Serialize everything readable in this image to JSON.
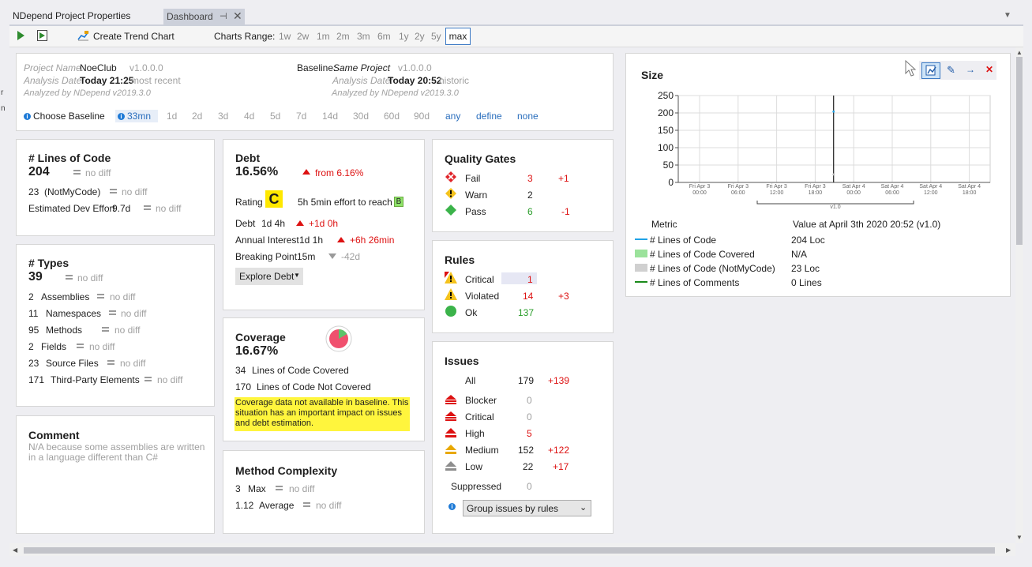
{
  "window": {
    "title": "NDepend Project Properties",
    "tab_label": "Dashboard",
    "tab_pin": "⊣",
    "tab_close": "✕"
  },
  "toolbar": {
    "create_trend_chart": "Create Trend Chart",
    "charts_range_label": "Charts Range:",
    "ranges": [
      "1w",
      "2w",
      "1m",
      "2m",
      "3m",
      "6m",
      "1y",
      "2y",
      "5y"
    ],
    "selected_range": "max"
  },
  "project": {
    "name_label": "Project Name:",
    "name": "NoeClub",
    "version": "v1.0.0.0",
    "analysis_label": "Analysis Date:",
    "analysis_date": "Today 21:25",
    "analysis_note": "most recent",
    "analyzed_by": "Analyzed by NDepend v2019.3.0",
    "baseline_label": "Baseline:",
    "baseline": "Same Project",
    "baseline_version": "v1.0.0.0",
    "baseline_date": "Today 20:52",
    "baseline_note": "historic",
    "baseline_analyzed_by": "Analyzed by NDepend v2019.3.0",
    "choose_baseline": "Choose Baseline",
    "baseline_options": [
      "33mn",
      "1d",
      "2d",
      "3d",
      "4d",
      "5d",
      "7d",
      "14d",
      "30d",
      "60d",
      "90d"
    ],
    "baseline_links": [
      "any",
      "define",
      "none"
    ]
  },
  "loc": {
    "title": "# Lines of Code",
    "value": "204",
    "diff": "no diff",
    "notmycode_value": "23",
    "notmycode_label": "(NotMyCode)",
    "notmycode_diff": "no diff",
    "effort_label": "Estimated Dev Effort",
    "effort_value": "9.7d",
    "effort_diff": "no diff"
  },
  "types": {
    "title": "# Types",
    "value": "39",
    "diff": "no diff",
    "rows": [
      {
        "value": "2",
        "label": "Assemblies",
        "diff": "no diff"
      },
      {
        "value": "11",
        "label": "Namespaces",
        "diff": "no diff"
      },
      {
        "value": "95",
        "label": "Methods",
        "diff": "no diff"
      },
      {
        "value": "2",
        "label": "Fields",
        "diff": "no diff"
      },
      {
        "value": "23",
        "label": "Source Files",
        "diff": "no diff"
      },
      {
        "value": "171",
        "label": "Third-Party Elements",
        "diff": "no diff"
      }
    ]
  },
  "comment": {
    "title": "Comment",
    "text": "N/A because some assemblies are written in a language different than C#"
  },
  "debt": {
    "title": "Debt",
    "value": "16.56%",
    "from": "from 6.16%",
    "rating_label": "Rating",
    "rating": "C",
    "effort": "5h  5min effort to reach",
    "target": "B",
    "debt_label": "Debt",
    "debt_value": "1d  4h",
    "debt_delta": "+1d  0h",
    "interest_label": "Annual Interest",
    "interest_value": "1d  1h",
    "interest_delta": "+6h  26min",
    "breaking_label": "Breaking Point",
    "breaking_value": "15m",
    "breaking_delta": "-42d",
    "explore": "Explore Debt"
  },
  "coverage": {
    "title": "Coverage",
    "value": "16.67%",
    "pie_fraction": 0.1667,
    "covered_value": "34",
    "covered_label": "Lines of Code Covered",
    "not_covered_value": "170",
    "not_covered_label": "Lines of Code Not Covered",
    "warning": "Coverage data not available in baseline. This situation has an important impact on issues and debt estimation."
  },
  "complexity": {
    "title": "Method Complexity",
    "max_value": "3",
    "max_label": "Max",
    "max_diff": "no diff",
    "avg_value": "1.12",
    "avg_label": "Average",
    "avg_diff": "no diff"
  },
  "quality_gates": {
    "title": "Quality Gates",
    "rows": [
      {
        "label": "Fail",
        "value": "3",
        "delta": "+1"
      },
      {
        "label": "Warn",
        "value": "2",
        "delta": ""
      },
      {
        "label": "Pass",
        "value": "6",
        "delta": "-1"
      }
    ]
  },
  "rules": {
    "title": "Rules",
    "rows": [
      {
        "label": "Critical",
        "value": "1",
        "delta": ""
      },
      {
        "label": "Violated",
        "value": "14",
        "delta": "+3"
      },
      {
        "label": "Ok",
        "value": "137",
        "delta": ""
      }
    ]
  },
  "issues": {
    "title": "Issues",
    "all_label": "All",
    "all_value": "179",
    "all_delta": "+139",
    "rows": [
      {
        "label": "Blocker",
        "value": "0",
        "delta": ""
      },
      {
        "label": "Critical",
        "value": "0",
        "delta": ""
      },
      {
        "label": "High",
        "value": "5",
        "delta": ""
      },
      {
        "label": "Medium",
        "value": "152",
        "delta": "+122"
      },
      {
        "label": "Low",
        "value": "22",
        "delta": "+17"
      }
    ],
    "suppressed_label": "Suppressed",
    "suppressed_value": "0",
    "group_by": "Group issues by rules"
  },
  "size_chart": {
    "title": "Size",
    "legend_metric_header": "Metric",
    "legend_value_header": "Value at April 3th 2020  20:52  (v1.0)",
    "legend": [
      {
        "name": "# Lines of Code",
        "value": "204 Loc",
        "color": "#1fa2e6"
      },
      {
        "name": "# Lines of Code Covered",
        "value": "N/A",
        "color": "#9be29b"
      },
      {
        "name": "# Lines of Code (NotMyCode)",
        "value": "23 Loc",
        "color": "#d0d0d0"
      },
      {
        "name": "# Lines of Comments",
        "value": "0 Lines",
        "color": "#1a8a1a"
      }
    ],
    "marker_label": "v1.0"
  },
  "chart_data": {
    "type": "line",
    "title": "Size",
    "ylim": [
      0,
      250
    ],
    "yticks": [
      0,
      50,
      100,
      150,
      200,
      250
    ],
    "xticks": [
      [
        "Fri Apr 3",
        "00:00"
      ],
      [
        "Fri Apr 3",
        "06:00"
      ],
      [
        "Fri Apr 3",
        "12:00"
      ],
      [
        "Fri Apr 3",
        "18:00"
      ],
      [
        "Sat Apr 4",
        "00:00"
      ],
      [
        "Sat Apr 4",
        "06:00"
      ],
      [
        "Sat Apr 4",
        "12:00"
      ],
      [
        "Sat Apr 4",
        "18:00"
      ]
    ],
    "series": [
      {
        "name": "# Lines of Code",
        "x": [
          "2020-04-03 20:52"
        ],
        "values": [
          204
        ]
      },
      {
        "name": "# Lines of Code (NotMyCode)",
        "x": [
          "2020-04-03 20:52"
        ],
        "values": [
          23
        ]
      }
    ],
    "grid": true
  }
}
